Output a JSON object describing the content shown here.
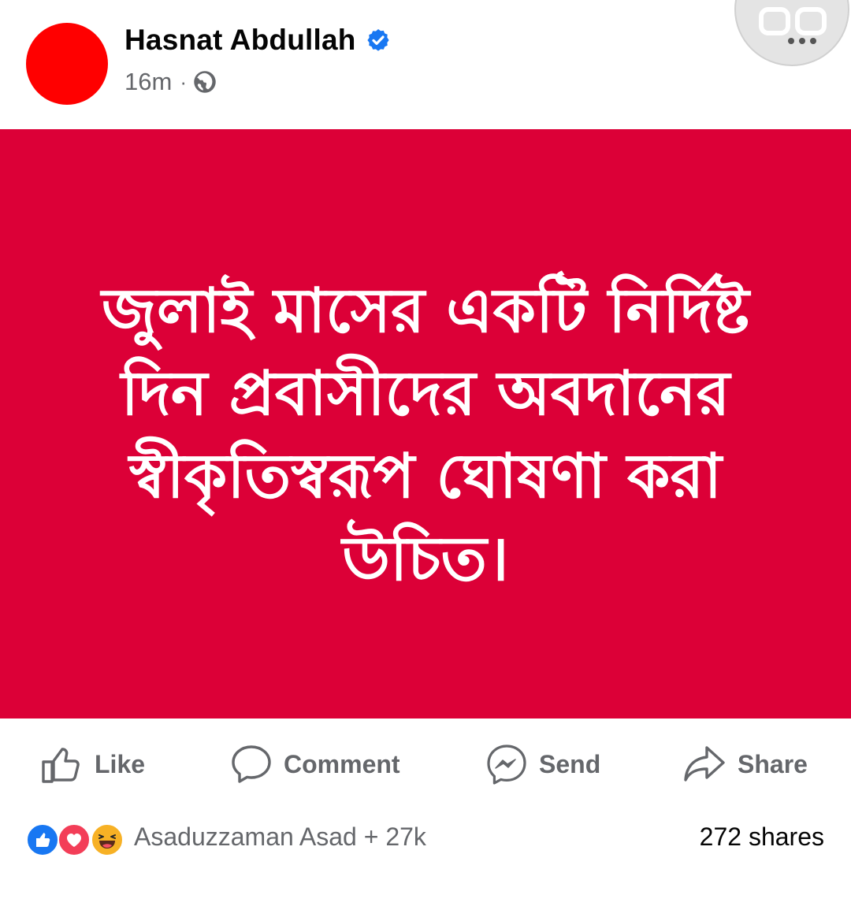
{
  "post": {
    "author": "Hasnat Abdullah",
    "verified_icon": "verified-badge-icon",
    "time": "16m",
    "separator": "·",
    "privacy_icon": "globe-icon",
    "menu_icon": "more-options-icon",
    "avatar_color": "#ff0000",
    "image": {
      "background": "#dc0037",
      "text_lines": [
        "জুলাই মাসের একটি নির্দিষ্ট",
        "দিন প্রবাসীদের অবদানের",
        "স্বীকৃতিস্বরূপ ঘোষণা করা",
        "উচিত।"
      ]
    }
  },
  "actions": {
    "like": "Like",
    "comment": "Comment",
    "send": "Send",
    "share": "Share"
  },
  "stats": {
    "reactions": [
      "like",
      "love",
      "haha"
    ],
    "reactors": "Asaduzzaman Asad + 27k",
    "shares": "272 shares"
  },
  "colors": {
    "facebook_blue": "#1877f2",
    "secondary_text": "#65676b",
    "love_red": "#f33e58",
    "haha_yellow": "#f7b125"
  }
}
